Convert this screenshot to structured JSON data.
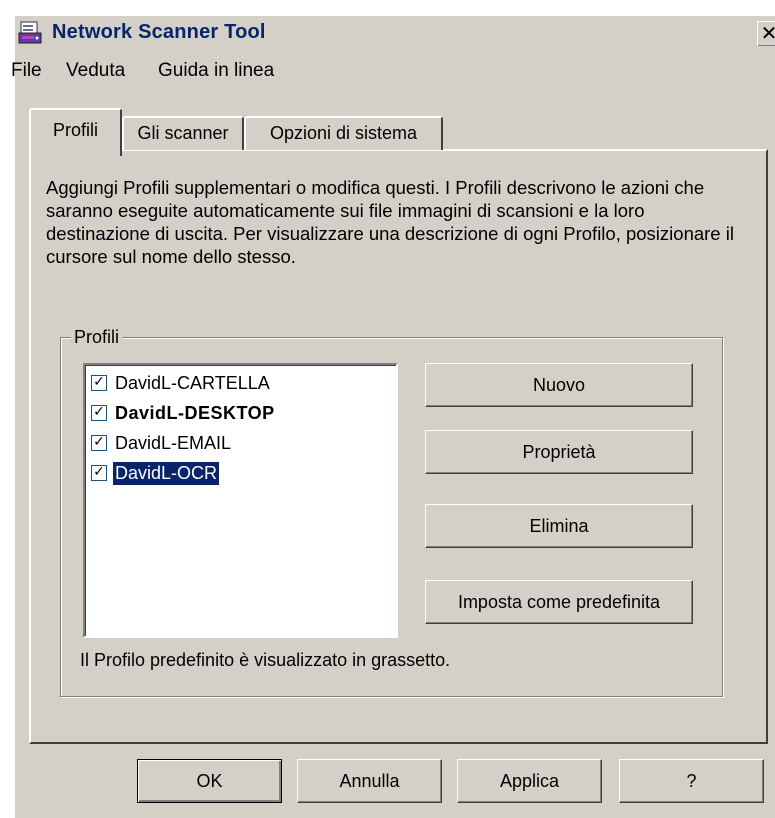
{
  "window": {
    "title": "Network Scanner Tool",
    "close_glyph": "✕"
  },
  "menu": [
    "File",
    "Veduta",
    "Guida in linea"
  ],
  "tabs": [
    {
      "label": "Profili",
      "active": true
    },
    {
      "label": "Gli scanner",
      "active": false
    },
    {
      "label": "Opzioni di sistema",
      "active": false
    }
  ],
  "description": "Aggiungi Profili supplementari o modifica questi. I Profili descrivono le azioni che saranno eseguite automaticamente sui file immagini di scansioni  e la loro destinazione di uscita. Per visualizzare una descrizione di ogni Profilo, posizionare il cursore sul nome dello stesso.",
  "profiles_group": {
    "label": "Profili",
    "items": [
      {
        "label": "DavidL-CARTELLA",
        "checked": true,
        "default": false,
        "selected": false
      },
      {
        "label": "DavidL-DESKTOP",
        "checked": true,
        "default": true,
        "selected": false
      },
      {
        "label": "DavidL-EMAIL",
        "checked": true,
        "default": false,
        "selected": false
      },
      {
        "label": "DavidL-OCR",
        "checked": true,
        "default": false,
        "selected": true
      }
    ],
    "buttons": {
      "new": "Nuovo",
      "properties": "Proprietà",
      "delete": "Elimina",
      "set_default": "Imposta come predefinita"
    },
    "hint": "Il Profilo predefinito è visualizzato in grassetto."
  },
  "footer_buttons": {
    "ok": "OK",
    "cancel": "Annulla",
    "apply": "Applica",
    "help": "?"
  },
  "icons": {
    "app": "scanner-app-icon",
    "checkbox_mark": "✓"
  },
  "colors": {
    "selection": "#0a246a",
    "title_text": "#0a246a",
    "face": "#d4d0c8"
  }
}
